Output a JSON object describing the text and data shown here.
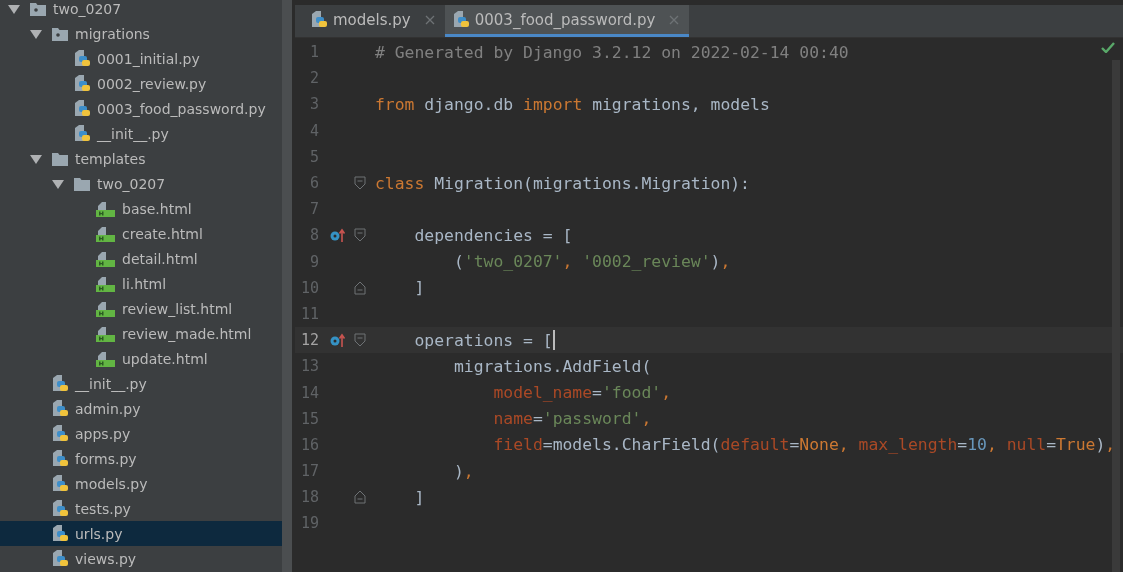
{
  "project_tree": [
    {
      "name": "two_0207",
      "kind": "package",
      "expanded": true,
      "selected": false,
      "children": [
        {
          "name": "migrations",
          "kind": "package",
          "expanded": true,
          "selected": false,
          "children": [
            {
              "name": "0001_initial.py",
              "kind": "python",
              "selected": false
            },
            {
              "name": "0002_review.py",
              "kind": "python",
              "selected": false
            },
            {
              "name": "0003_food_password.py",
              "kind": "python",
              "selected": false
            },
            {
              "name": "__init__.py",
              "kind": "python",
              "selected": false
            }
          ]
        },
        {
          "name": "templates",
          "kind": "folder",
          "expanded": true,
          "selected": false,
          "children": [
            {
              "name": "two_0207",
              "kind": "folder",
              "expanded": true,
              "selected": false,
              "children": [
                {
                  "name": "base.html",
                  "kind": "html",
                  "selected": false
                },
                {
                  "name": "create.html",
                  "kind": "html",
                  "selected": false
                },
                {
                  "name": "detail.html",
                  "kind": "html",
                  "selected": false
                },
                {
                  "name": "li.html",
                  "kind": "html",
                  "selected": false
                },
                {
                  "name": "review_list.html",
                  "kind": "html",
                  "selected": false
                },
                {
                  "name": "review_made.html",
                  "kind": "html",
                  "selected": false
                },
                {
                  "name": "update.html",
                  "kind": "html",
                  "selected": false
                }
              ]
            }
          ]
        },
        {
          "name": "__init__.py",
          "kind": "python",
          "selected": false
        },
        {
          "name": "admin.py",
          "kind": "python",
          "selected": false
        },
        {
          "name": "apps.py",
          "kind": "python",
          "selected": false
        },
        {
          "name": "forms.py",
          "kind": "python",
          "selected": false
        },
        {
          "name": "models.py",
          "kind": "python",
          "selected": false
        },
        {
          "name": "tests.py",
          "kind": "python",
          "selected": false
        },
        {
          "name": "urls.py",
          "kind": "python",
          "selected": true
        },
        {
          "name": "views.py",
          "kind": "python",
          "selected": false
        }
      ]
    }
  ],
  "tabs": [
    {
      "label": "models.py",
      "selected": false
    },
    {
      "label": "0003_food_password.py",
      "selected": true
    }
  ],
  "editor": {
    "lines": [
      {
        "number": "1",
        "current": false,
        "tokens": [
          {
            "kind": "comment",
            "text": "# Generated by Django 3.2.12 on 2022-02-14 00:40"
          }
        ]
      },
      {
        "number": "2",
        "current": false
      },
      {
        "number": "3",
        "current": false,
        "tokens": [
          {
            "kind": "keyword",
            "text": "from"
          },
          {
            "kind": "plain",
            "text": " django.db "
          },
          {
            "kind": "keyword",
            "text": "import"
          },
          {
            "kind": "plain",
            "text": " migrations, models"
          }
        ]
      },
      {
        "number": "4",
        "current": false
      },
      {
        "number": "5",
        "current": false
      },
      {
        "number": "6",
        "current": false,
        "fold_start": true,
        "tokens": [
          {
            "kind": "keyword",
            "text": "class"
          },
          {
            "kind": "plain",
            "text": " Migration(migrations.Migration):"
          }
        ]
      },
      {
        "number": "7",
        "current": false
      },
      {
        "number": "8",
        "current": false,
        "fold_start": true,
        "override": true,
        "tokens": [
          {
            "kind": "plain",
            "text": "    dependencies = ["
          }
        ]
      },
      {
        "number": "9",
        "current": false,
        "tokens": [
          {
            "kind": "plain",
            "text": "        ("
          },
          {
            "kind": "string",
            "text": "'two_0207'"
          },
          {
            "kind": "keyword",
            "text": ", "
          },
          {
            "kind": "string",
            "text": "'0002_review'"
          },
          {
            "kind": "plain",
            "text": ")"
          },
          {
            "kind": "keyword",
            "text": ","
          }
        ]
      },
      {
        "number": "10",
        "current": false,
        "fold_end": true,
        "tokens": [
          {
            "kind": "plain",
            "text": "    ]"
          }
        ]
      },
      {
        "number": "11",
        "current": false
      },
      {
        "number": "12",
        "current": true,
        "fold_start": true,
        "override": true,
        "tokens": [
          {
            "kind": "plain",
            "text": "    operations = ["
          }
        ]
      },
      {
        "number": "13",
        "current": false,
        "tokens": [
          {
            "kind": "plain",
            "text": "        migrations.AddField("
          }
        ]
      },
      {
        "number": "14",
        "current": false,
        "tokens": [
          {
            "kind": "param",
            "text": "            model_name"
          },
          {
            "kind": "plain",
            "text": "="
          },
          {
            "kind": "string",
            "text": "'food'"
          },
          {
            "kind": "keyword",
            "text": ","
          }
        ]
      },
      {
        "number": "15",
        "current": false,
        "tokens": [
          {
            "kind": "param",
            "text": "            name"
          },
          {
            "kind": "plain",
            "text": "="
          },
          {
            "kind": "string",
            "text": "'password'"
          },
          {
            "kind": "keyword",
            "text": ","
          }
        ]
      },
      {
        "number": "16",
        "current": false,
        "tokens": [
          {
            "kind": "param",
            "text": "            field"
          },
          {
            "kind": "plain",
            "text": "=models.CharField("
          },
          {
            "kind": "param",
            "text": "default"
          },
          {
            "kind": "plain",
            "text": "="
          },
          {
            "kind": "keyword",
            "text": "None"
          },
          {
            "kind": "keyword",
            "text": ", "
          },
          {
            "kind": "param",
            "text": "max_length"
          },
          {
            "kind": "plain",
            "text": "="
          },
          {
            "kind": "number",
            "text": "10"
          },
          {
            "kind": "keyword",
            "text": ", "
          },
          {
            "kind": "param",
            "text": "null"
          },
          {
            "kind": "plain",
            "text": "="
          },
          {
            "kind": "keyword",
            "text": "True"
          },
          {
            "kind": "plain",
            "text": ")"
          },
          {
            "kind": "keyword",
            "text": ","
          }
        ]
      },
      {
        "number": "17",
        "current": false,
        "tokens": [
          {
            "kind": "plain",
            "text": "        )"
          },
          {
            "kind": "keyword",
            "text": ","
          }
        ]
      },
      {
        "number": "18",
        "current": false,
        "fold_end": true,
        "tokens": [
          {
            "kind": "plain",
            "text": "    ]"
          }
        ]
      },
      {
        "number": "19",
        "current": false
      }
    ]
  }
}
